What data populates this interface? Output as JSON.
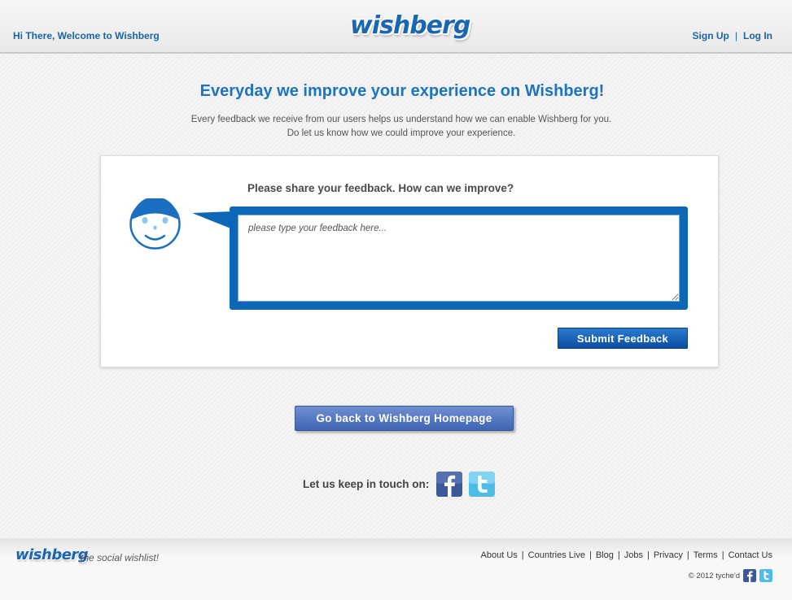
{
  "header": {
    "welcome": "Hi There, Welcome to Wishberg",
    "logo": "wishberg",
    "sign_up": "Sign Up",
    "separator": "|",
    "log_in": "Log In"
  },
  "intro": {
    "headline": "Everyday we improve your experience on Wishberg!",
    "line1": "Every feedback we receive from our users helps us understand how we can enable Wishberg for you.",
    "line2": "Do let us know how we could improve your experience."
  },
  "feedback": {
    "prompt": "Please share your feedback. How can we improve?",
    "placeholder": "please type your feedback here...",
    "value": "",
    "submit_label": "Submit Feedback"
  },
  "home_button": "Go back to Wishberg Homepage",
  "touch": {
    "label": "Let us keep in touch on:",
    "icons": [
      "facebook-icon",
      "twitter-icon"
    ]
  },
  "footer": {
    "logo": "wishberg",
    "tagline": "the social wishlist!",
    "links": [
      "About Us",
      "Countries Live",
      "Blog",
      "Jobs",
      "Privacy",
      "Terms",
      "Contact Us"
    ],
    "copyright": "© 2012 tyche'd"
  },
  "colors": {
    "brand_blue": "#1b66b3",
    "bubble_blue": "#0e67b6",
    "button_blue": "#0a4ea0",
    "home_button": "#4f72bd",
    "facebook": "#3b5998",
    "twitter": "#4fbce8"
  }
}
